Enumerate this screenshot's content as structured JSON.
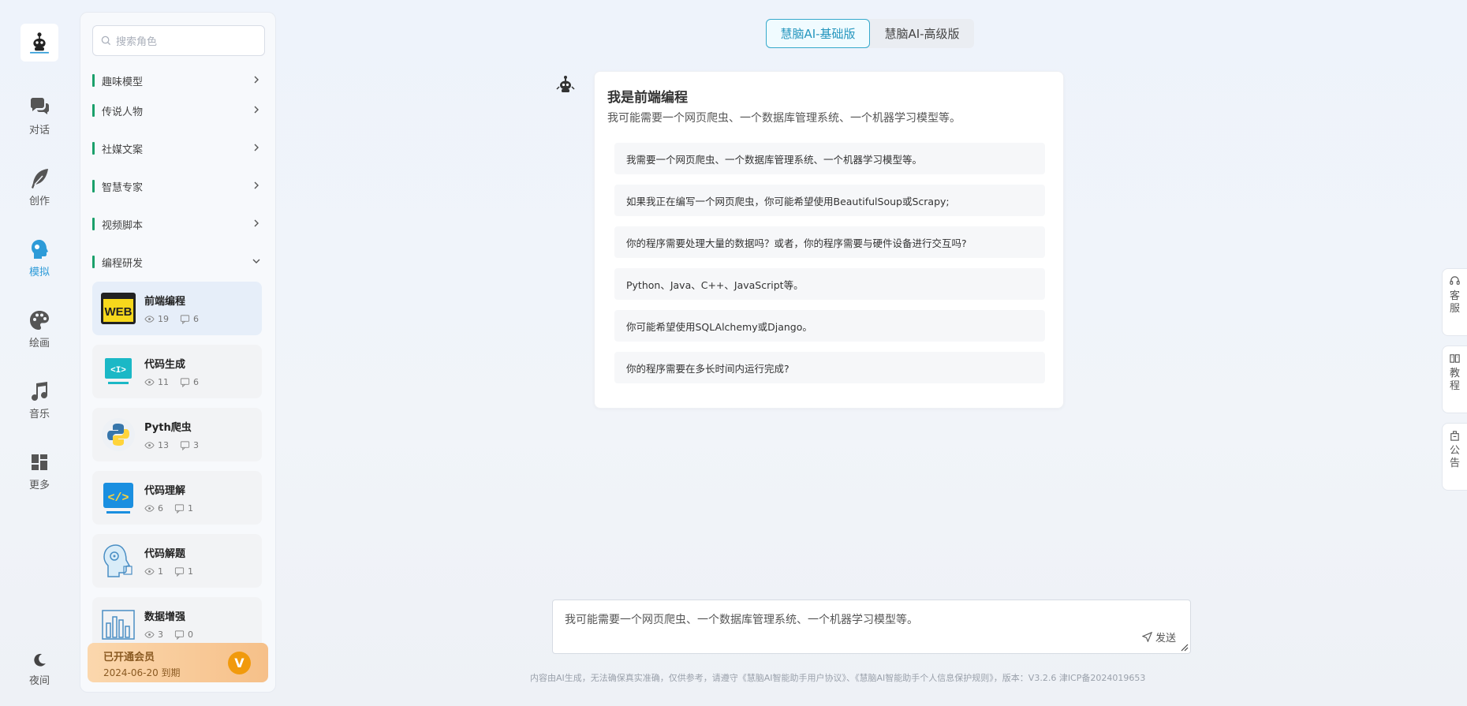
{
  "rail": {
    "items": [
      {
        "label": "对话",
        "icon": "chat-icon"
      },
      {
        "label": "创作",
        "icon": "feather-icon"
      },
      {
        "label": "模拟",
        "icon": "head-icon"
      },
      {
        "label": "绘画",
        "icon": "palette-icon"
      },
      {
        "label": "音乐",
        "icon": "music-icon"
      },
      {
        "label": "更多",
        "icon": "grid-icon"
      }
    ],
    "night_label": "夜间"
  },
  "panel": {
    "search_placeholder": "搜索角色",
    "categories": [
      "趣味模型",
      "传说人物",
      "社媒文案",
      "智慧专家",
      "视频脚本",
      "编程研发"
    ],
    "cards": [
      {
        "title": "前端编程",
        "views": "19",
        "comments": "6",
        "icon": "web-icon"
      },
      {
        "title": "代码生成",
        "views": "11",
        "comments": "6",
        "icon": "code-monitor-icon"
      },
      {
        "title": "Pyth爬虫",
        "views": "13",
        "comments": "3",
        "icon": "python-icon"
      },
      {
        "title": "代码理解",
        "views": "6",
        "comments": "1",
        "icon": "code-brackets-icon"
      },
      {
        "title": "代码解题",
        "views": "1",
        "comments": "1",
        "icon": "brain-icon"
      },
      {
        "title": "数据增强",
        "views": "3",
        "comments": "0",
        "icon": "bar-chart-icon"
      }
    ],
    "member": {
      "title": "已开通会员",
      "expire": "2024-06-20 到期",
      "badge": "V"
    }
  },
  "version_tabs": [
    "慧脑AI-基础版",
    "慧脑AI-高级版"
  ],
  "chat": {
    "title": "我是前端编程",
    "subtitle": "我可能需要一个网页爬虫、一个数据库管理系统、一个机器学习模型等。",
    "suggestions": [
      "我需要一个网页爬虫、一个数据库管理系统、一个机器学习模型等。",
      "如果我正在编写一个网页爬虫，你可能希望使用BeautifulSoup或Scrapy;",
      "你的程序需要处理大量的数据吗？或者，你的程序需要与硬件设备进行交互吗?",
      "Python、Java、C++、JavaScript等。",
      "你可能希望使用SQLAlchemy或Django。",
      "你的程序需要在多长时间内运行完成?"
    ]
  },
  "input": {
    "value": "我可能需要一个网页爬虫、一个数据库管理系统、一个机器学习模型等。",
    "send_label": "发送"
  },
  "footer": "内容由AI生成，无法确保真实准确，仅供参考，请遵守《慧脑AI智能助手用户协议》、《慧脑AI智能助手个人信息保护规则》，版本：V3.2.6    津ICP备2024019653",
  "side_tabs": [
    {
      "l1": "客",
      "l2": "服",
      "icon": "headset-icon"
    },
    {
      "l1": "教",
      "l2": "程",
      "icon": "book-icon"
    },
    {
      "l1": "公",
      "l2": "告",
      "icon": "notice-icon"
    }
  ],
  "colors": {
    "accent": "#2d9bd8",
    "category_bar": "#1aa06b",
    "tab_active": "#2596be",
    "member_bg": "#f6c089"
  }
}
